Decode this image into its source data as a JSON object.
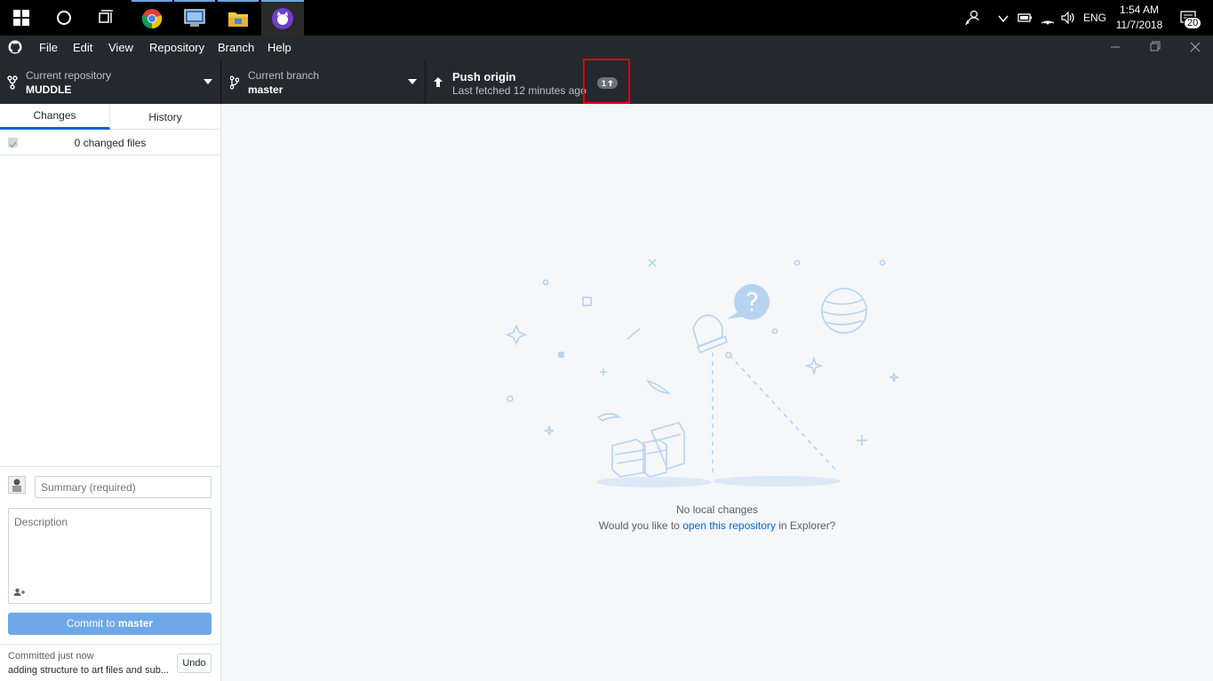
{
  "taskbar": {
    "clock_time": "1:54 AM",
    "clock_date": "11/7/2018",
    "language": "ENG",
    "notification_count": "20"
  },
  "menu": {
    "items": [
      "File",
      "Edit",
      "View",
      "Repository",
      "Branch",
      "Help"
    ]
  },
  "toolbar": {
    "repo_label": "Current repository",
    "repo_name": "MUDDLE",
    "branch_label": "Current branch",
    "branch_name": "master",
    "push_title": "Push origin",
    "push_subtitle": "Last fetched 12 minutes ago",
    "push_badge": "1"
  },
  "sidebar": {
    "tab_changes": "Changes",
    "tab_history": "History",
    "changed_files": "0 changed files",
    "summary_placeholder": "Summary (required)",
    "description_placeholder": "Description",
    "commit_prefix": "Commit to ",
    "commit_branch": "master",
    "last_commit_status": "Committed just now",
    "last_commit_message": "adding structure to art files and sub...",
    "undo_label": "Undo"
  },
  "main": {
    "empty_title": "No local changes",
    "empty_prefix": "Would you like to ",
    "empty_link": "open this repository",
    "empty_suffix": " in Explorer?"
  },
  "colors": {
    "toolbar_bg": "#24292e",
    "accent_blue": "#0366d6",
    "commit_button": "#6fa8e8",
    "highlight_red": "#e0000e"
  }
}
